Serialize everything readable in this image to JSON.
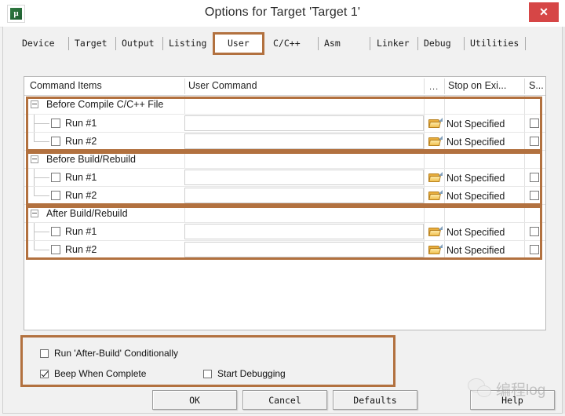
{
  "window": {
    "title": "Options for Target 'Target 1'",
    "app_icon": "uvision-icon",
    "app_icon_glyph": "µ",
    "close_label": "✕"
  },
  "tabs": [
    {
      "label": "Device",
      "selected": false
    },
    {
      "label": "Target",
      "selected": false
    },
    {
      "label": "Output",
      "selected": false
    },
    {
      "label": "Listing",
      "selected": false
    },
    {
      "label": "User",
      "selected": true
    },
    {
      "label": "C/C++",
      "selected": false
    },
    {
      "label": "Asm",
      "selected": false
    },
    {
      "label": "Linker",
      "selected": false
    },
    {
      "label": "Debug",
      "selected": false
    },
    {
      "label": "Utilities",
      "selected": false
    }
  ],
  "table": {
    "columns": [
      {
        "key": "command_items",
        "label": "Command Items"
      },
      {
        "key": "user_command",
        "label": "User Command"
      },
      {
        "key": "dots",
        "label": "..."
      },
      {
        "key": "stop_on_exit",
        "label": "Stop on Exi..."
      },
      {
        "key": "s",
        "label": "S..."
      }
    ],
    "groups": [
      {
        "label": "Before Compile C/C++ File",
        "expanded": true,
        "highlighted": true,
        "rows": [
          {
            "label": "Run #1",
            "checked": false,
            "user_command": "",
            "browse_icon": "folder-open-icon",
            "stop_on_exit": "Not Specified",
            "s_checked": false
          },
          {
            "label": "Run #2",
            "checked": false,
            "user_command": "",
            "browse_icon": "folder-open-icon",
            "stop_on_exit": "Not Specified",
            "s_checked": false
          }
        ]
      },
      {
        "label": "Before Build/Rebuild",
        "expanded": true,
        "highlighted": true,
        "rows": [
          {
            "label": "Run #1",
            "checked": false,
            "user_command": "",
            "browse_icon": "folder-open-icon",
            "stop_on_exit": "Not Specified",
            "s_checked": false
          },
          {
            "label": "Run #2",
            "checked": false,
            "user_command": "",
            "browse_icon": "folder-open-icon",
            "stop_on_exit": "Not Specified",
            "s_checked": false
          }
        ]
      },
      {
        "label": "After Build/Rebuild",
        "expanded": true,
        "highlighted": true,
        "rows": [
          {
            "label": "Run #1",
            "checked": false,
            "user_command": "",
            "browse_icon": "folder-open-icon",
            "stop_on_exit": "Not Specified",
            "s_checked": false
          },
          {
            "label": "Run #2",
            "checked": false,
            "user_command": "",
            "browse_icon": "folder-open-icon",
            "stop_on_exit": "Not Specified",
            "s_checked": false
          }
        ]
      }
    ]
  },
  "options": {
    "highlighted": true,
    "items": [
      {
        "label": "Run 'After-Build' Conditionally",
        "checked": false
      },
      {
        "label": "Beep When Complete",
        "checked": true
      },
      {
        "label": "Start Debugging",
        "checked": false
      }
    ]
  },
  "buttons": {
    "ok": "OK",
    "cancel": "Cancel",
    "defaults": "Defaults",
    "help": "Help"
  },
  "watermark": {
    "text": "编程log",
    "icon": "wechat-icon"
  },
  "colors": {
    "highlight": "#b2713f",
    "close": "#d64646",
    "dialog_bg": "#f1f1f1",
    "folder": "#e8ae3e"
  }
}
